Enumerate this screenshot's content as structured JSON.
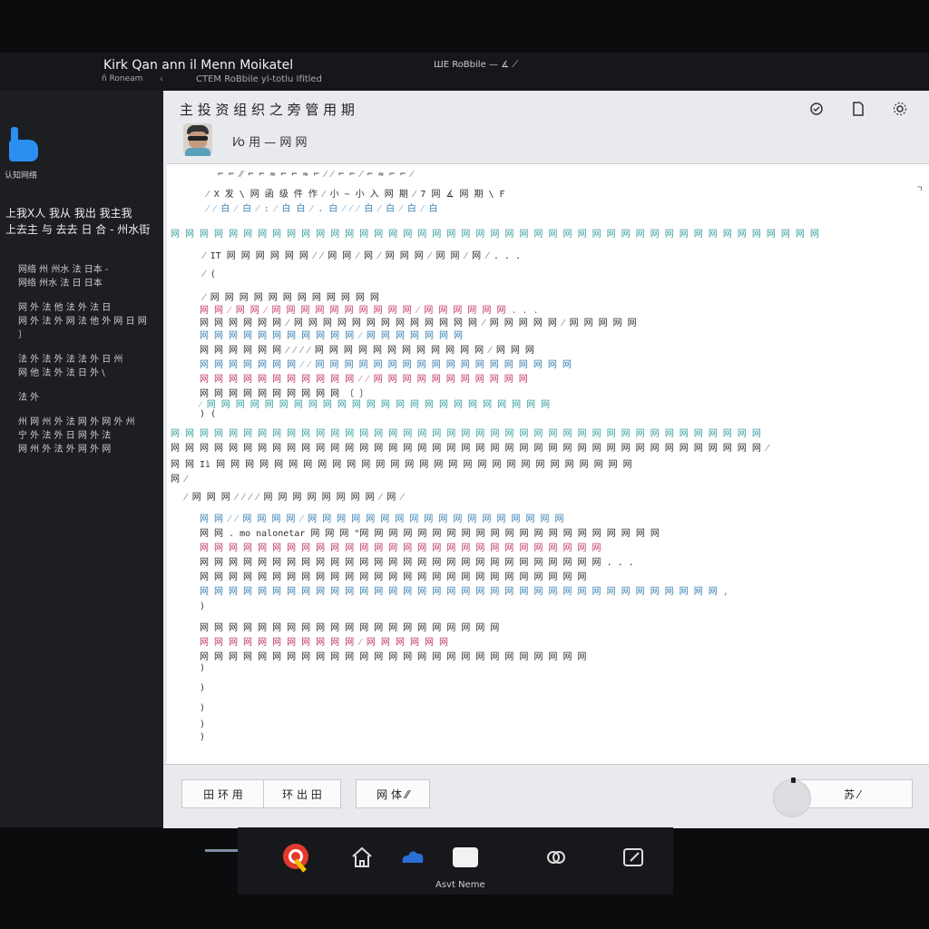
{
  "window": {
    "app_title": "Kirk Qan ann il Menn Moikatel",
    "app_subtitle": "ñ Roneam",
    "window_subtitle": "CTEM RoBbile yl-totlu Ifitled",
    "center_title": "ШЕ RoBbile — ∡ ⟋"
  },
  "sidebar": {
    "logo_label": "认知网络",
    "heading_line1": "上我X人 我从 我出 我主我",
    "heading_line2": "上去主 与 去去 日 合 - 州水街",
    "items": [
      {
        "label": "网络 州 州水 法 日本 -\n网络 州水 法 日 日本"
      },
      {
        "label": "网 外 法 他 法 外 法 日\n网 外 法 外 网 法 他 外 网 日 网\n〕"
      },
      {
        "label": "法 外 法 外 法 法 外 日 州\n网 他 法 外 法 日 外 \\"
      },
      {
        "label": "法 外"
      },
      {
        "label": "州 网 州 外 法 网 外 网 外 州\n宁 外 法 外 日 网 外 法\n网 州 外 法 外 网 外 网"
      }
    ]
  },
  "main": {
    "title": "主 投 资 组 织 之 旁 管 用 期",
    "user_name": "I⁄o 用 — 网 网",
    "header_icons": [
      "check-circle-icon",
      "document-icon",
      "settings-icon"
    ]
  },
  "editor": {
    "lines": [
      {
        "t": "⌐ ⌐ ⁄⁄ ⌐ ⌐ ≈ ⌐ ⌐ ≈ ⌐ ⁄ ⁄ ⌐ ⌐ ⁄ ⌐ ≈ ⌐ ⌐ ⁄",
        "c": ""
      },
      {
        "t": "⁄ X 发 \\ 网 函 级 件 作 ⁄ 小 ~ 小 入 网 期 ⁄ 7 网 ∡ 网 期 \\ F",
        "c": ""
      },
      {
        "t": "⁄ ⁄ 白 ⁄ 白 ⁄ : ⁄ 白 白 ⁄ . 白 ⁄ ⁄ ⁄ 白 ⁄ 白 ⁄ 白 ⁄ 白",
        "c": "code-blue"
      },
      {
        "t": "网 网 网 网 网 网 网 网 网 网 网 网 网 网 网 网 网 网 网 网 网 网 网 网 网 网 网 网 网 网 网 网 网 网 网 网 网 网 网 网 网 网 网 网 网",
        "c": "code-teal"
      },
      {
        "t": "⁄ IT 网 网 网 网 网 网 ⁄ ⁄ 网 网 ⁄ 网 ⁄ 网 网 网 ⁄ 网 网 ⁄ 网 ⁄ . . .",
        "c": ""
      },
      {
        "t": "⁄ (",
        "c": ""
      },
      {
        "t": "⁄ 网 网 网 网 网 网 网 网 网 网 网 网",
        "c": ""
      },
      {
        "t": "网 网 ⁄ 网 网 ⁄ 网 网 网 网 网 网 网 网 网 网 ⁄ 网 网 网 网 网 网 . . .",
        "c": "code-pink"
      },
      {
        "t": "网 网 网 网 网 网 ⁄ 网 网 网 网 网 网 网 网 网 网 网 网 网 ⁄ 网 网 网 网 网 ⁄ 网 网 网 网 网",
        "c": ""
      },
      {
        "t": "网 网 网 网 网 网 网 网 网 网 网 ⁄ 网 网 网 网 网 网 网",
        "c": "code-blue"
      },
      {
        "t": "网 网 网 网 网 网 ⁄ ⁄ ⁄ ⁄ 网 网 网 网 网 网 网 网 网 网 网 网 ⁄ 网 网 网",
        "c": ""
      },
      {
        "t": "网 网 网 网 网 网 网 ⁄ ⁄ 网 网 网 网 网 网 网 网 网 网 网 网 网 网 网 网 网 网",
        "c": "code-blue"
      },
      {
        "t": "网 网 网 网 网 网 网 网 网 网 网 ⁄ ⁄ 网 网 网 网 网 网 网 网 网 网 网",
        "c": "code-pink"
      },
      {
        "t": "网 网 网 网 网 网 网 网 网 网 〔 〕",
        "c": ""
      },
      {
        "t": "⁄ 网 网 网 网 网 网 网 网 网 网 网 网 网 网 网 网 网 网 网 网 网 网 网 网",
        "c": "code-teal"
      },
      {
        "t": ") (",
        "c": ""
      },
      {
        "t": "网 网 网 网 网 网 网 网 网 网 网 网 网 网 网 网 网 网 网 网 网 网 网 网 网 网 网 网 网 网 网 网 网 网 网 网 网 网 网 网 网",
        "c": "code-teal"
      },
      {
        "t": "网 网 网 网 网 网 网 网 网 网 网 网 网 网 网 网 网 网 网 网 网 网 网 网 网 网 网 网 网 网 网 网 网 网 网 网 网 网 网 网 网 ⁄",
        "c": ""
      },
      {
        "t": "网 网 Iì 网 网 网 网 网 网 网 网 网 网 网 网 网 网 网 网 网 网 网 网 网 网 网 网 网 网 网 网 网",
        "c": ""
      },
      {
        "t": "网 ⁄",
        "c": ""
      },
      {
        "t": "⁄ 网 网 网 ⁄ ⁄ ⁄ ⁄ 网 网 网 网 网 网 网 网 ⁄ 网 ⁄",
        "c": ""
      },
      {
        "t": "网 网 ⁄ ⁄ 网 网 网 网 ⁄ 网 网 网 网 网 网 网 网 网 网 网 网 网 网 网 网 网 网",
        "c": "code-blue"
      },
      {
        "t": "网 网 . mo nalonetar 网 网 网 \"网 网 网 网 网 网 网 网 网 网 网 网 网 网 网 网 网 网 网 网 网",
        "c": ""
      },
      {
        "t": "网 网 网 网 网 网 网 网 网 网 网 网 网 网 网 网 网 网 网 网 网 网 网 网 网 网 网 网",
        "c": "code-pink"
      },
      {
        "t": "网 网 网 网 网 网 网 网 网 网 网 网 网 网 网 网 网 网 网 网 网 网 网 网 网 网 网 网 . . .",
        "c": ""
      },
      {
        "t": "网 网 网 网 网 网 网 网 网 网 网 网 网 网 网 网 网 网 网 网 网 网 网 网 网 网 网",
        "c": ""
      },
      {
        "t": "网 网 网 网 网 网 网 网 网 网 网 网 网 网 网 网 网 网 网 网 网 网 网 网 网 网 网 网 网 网 网 网 网 网 网 网 ,",
        "c": "code-blue"
      },
      {
        "t": ")",
        "c": ""
      },
      {
        "t": "网 网 网 网 网 网 网 网 网 网 网 网 网 网 网 网 网 网 网 网 网",
        "c": ""
      },
      {
        "t": "网 网 网 网 网 网 网 网 网 网 网 ⁄ 网 网 网 网 网 网",
        "c": "code-pink"
      },
      {
        "t": "网 网 网 网 网 网 网 网 网 网 网 网 网 网 网 网 网 网 网 网 网 网 网 网 网 网 网",
        "c": ""
      },
      {
        "t": ")",
        "c": ""
      },
      {
        "t": ")",
        "c": ""
      },
      {
        "t": ")",
        "c": ""
      },
      {
        "t": ")",
        "c": ""
      },
      {
        "t": ")",
        "c": ""
      }
    ]
  },
  "footer": {
    "btn1": "田 环 用",
    "btn2": "环 出 田",
    "btn3": "网 体 ⁄⁄",
    "btn4": "苏 ⁄"
  },
  "taskbar": {
    "label": "Asvt Neme",
    "icons": [
      "browser-icon",
      "home-icon",
      "cloud-icon",
      "window-icon",
      "link-icon",
      "edit-icon"
    ]
  },
  "colors": {
    "accent": "#2a8ff0",
    "sidebar_bg": "#1c1e22",
    "main_bg": "#e9eaed"
  }
}
